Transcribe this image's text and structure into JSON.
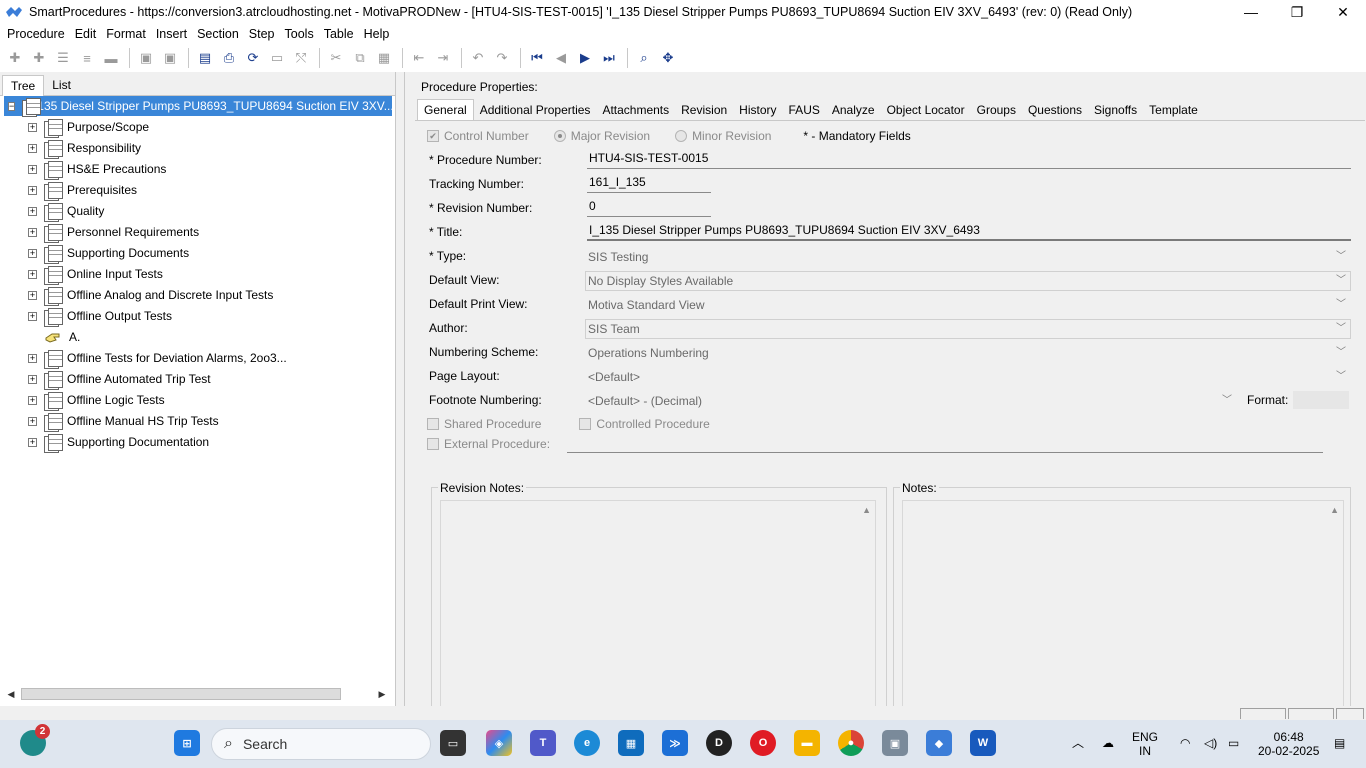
{
  "window": {
    "title": "SmartProcedures - https://conversion3.atrcloudhosting.net - MotivaPRODNew - [HTU4-SIS-TEST-0015] 'I_135 Diesel Stripper Pumps PU8693_TUPU8694 Suction EIV 3XV_6493' (rev: 0) (Read Only)",
    "minimize": "—",
    "maximize": "❐",
    "close": "✕"
  },
  "menu": [
    "Procedure",
    "Edit",
    "Format",
    "Insert",
    "Section",
    "Step",
    "Tools",
    "Table",
    "Help"
  ],
  "left_tabs": [
    "Tree",
    "List"
  ],
  "tree": {
    "root": "I_135  Diesel  Stripper  Pumps  PU8693_TUPU8694  Suction  EIV  3XV...",
    "items": [
      "Purpose/Scope",
      "Responsibility",
      "HS&E Precautions",
      "Prerequisites",
      "Quality",
      "Personnel Requirements",
      "Supporting Documents",
      "Online Input Tests",
      "Offline Analog and Discrete Input Tests",
      "Offline Output Tests",
      "A.",
      "Offline Tests for Deviation Alarms, 2oo3...",
      "Offline Automated Trip Test",
      "Offline Logic Tests",
      "Offline Manual HS Trip Tests",
      "Supporting Documentation"
    ]
  },
  "right": {
    "title": "Procedure Properties:",
    "tabs": [
      "General",
      "Additional Properties",
      "Attachments",
      "Revision",
      "History",
      "FAUS",
      "Analyze",
      "Object Locator",
      "Groups",
      "Questions",
      "Signoffs",
      "Template"
    ],
    "checks": {
      "control_number": "Control Number",
      "major_revision": "Major Revision",
      "minor_revision": "Minor Revision",
      "mandatory": "* - Mandatory Fields"
    },
    "fields": {
      "procedure_number_label": "* Procedure Number:",
      "procedure_number": "HTU4-SIS-TEST-0015",
      "tracking_number_label": "Tracking Number:",
      "tracking_number": "161_I_135",
      "revision_number_label": "* Revision Number:",
      "revision_number": "0",
      "title_label": "* Title:",
      "title": "I_135 Diesel Stripper Pumps PU8693_TUPU8694 Suction EIV 3XV_6493",
      "type_label": "* Type:",
      "type": "SIS Testing",
      "default_view_label": "Default View:",
      "default_view": "No Display Styles Available",
      "default_print_view_label": "Default Print View:",
      "default_print_view": "Motiva Standard View",
      "author_label": "Author:",
      "author": "SIS Team",
      "numbering_scheme_label": "Numbering Scheme:",
      "numbering_scheme": "Operations Numbering",
      "page_layout_label": "Page Layout:",
      "page_layout": "<Default>",
      "footnote_numbering_label": "Footnote Numbering:",
      "footnote_numbering": "<Default> - (Decimal)",
      "format_label": "Format:",
      "shared_procedure": "Shared Procedure",
      "controlled_procedure": "Controlled Procedure",
      "external_procedure": "External Procedure:"
    },
    "revision_notes_label": "Revision Notes:",
    "notes_label": "Notes:"
  },
  "taskbar": {
    "search_placeholder": "Search",
    "notification_count": "2",
    "lang_top": "ENG",
    "lang_bottom": "IN",
    "time": "06:48",
    "date": "20-02-2025"
  }
}
